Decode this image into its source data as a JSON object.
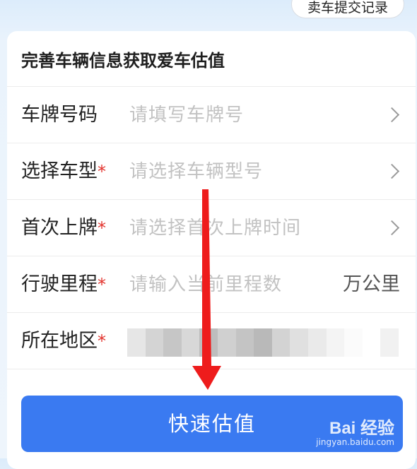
{
  "header": {
    "submit_records_link": "卖车提交记录"
  },
  "form": {
    "title": "完善车辆信息获取爱车估值",
    "required_mark": "*",
    "plate": {
      "label": "车牌号码",
      "placeholder": "请填写车牌号"
    },
    "model": {
      "label": "选择车型",
      "placeholder": "请选择车辆型号"
    },
    "first_registration": {
      "label": "首次上牌",
      "placeholder": "请选择首次上牌时间"
    },
    "mileage": {
      "label": "行驶里程",
      "placeholder": "请输入当前里程数",
      "unit": "万公里"
    },
    "region": {
      "label": "所在地区"
    }
  },
  "estimate_button": {
    "label": "快速估值"
  },
  "watermark": {
    "logo": "Bai 经验",
    "url": "jingyan.baidu.com"
  },
  "colors": {
    "accent_blue": "#3a7af1",
    "required_red": "#e2322c",
    "annotation_arrow_red": "#ee1c1c"
  },
  "icons": {
    "row_chevron": "chevron-right-icon"
  }
}
